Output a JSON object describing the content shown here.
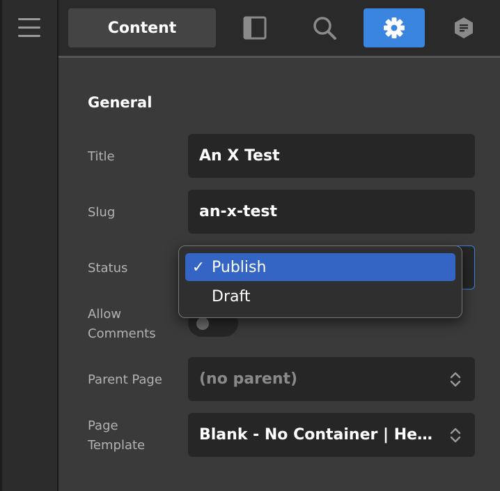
{
  "topbar": {
    "content_tab": "Content",
    "icons": [
      "sidebar-panel-icon",
      "search-icon",
      "gear-icon",
      "block-icon"
    ],
    "active_icon": "gear-icon",
    "accent": "#3a85e0"
  },
  "rail": {
    "menu_icon": "hamburger-menu-icon"
  },
  "general": {
    "heading": "General",
    "title_label": "Title",
    "title_value": "An X Test",
    "slug_label": "Slug",
    "slug_value": "an-x-test",
    "status_label": "Status",
    "status_value": "Publish",
    "allow_comments_label_line1": "Allow",
    "allow_comments_label_line2": "Comments",
    "allow_comments_on": false,
    "parent_label": "Parent Page",
    "parent_value": "(no parent)",
    "template_label_line1": "Page",
    "template_label_line2": "Template",
    "template_value": "Blank - No Container | Hea…"
  },
  "status_dropdown": {
    "check": "✓",
    "options": [
      "Publish",
      "Draft"
    ],
    "selected": "Publish",
    "highlight": "#3465c4"
  }
}
